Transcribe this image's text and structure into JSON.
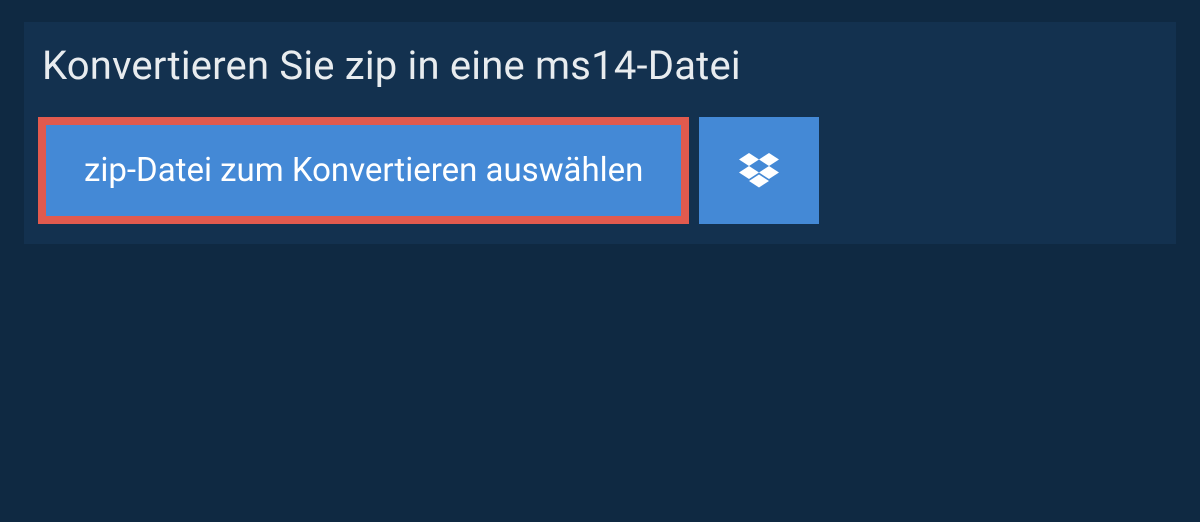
{
  "heading": "Konvertieren Sie zip in eine ms14-Datei",
  "select_button_label": "zip-Datei zum Konvertieren auswählen"
}
